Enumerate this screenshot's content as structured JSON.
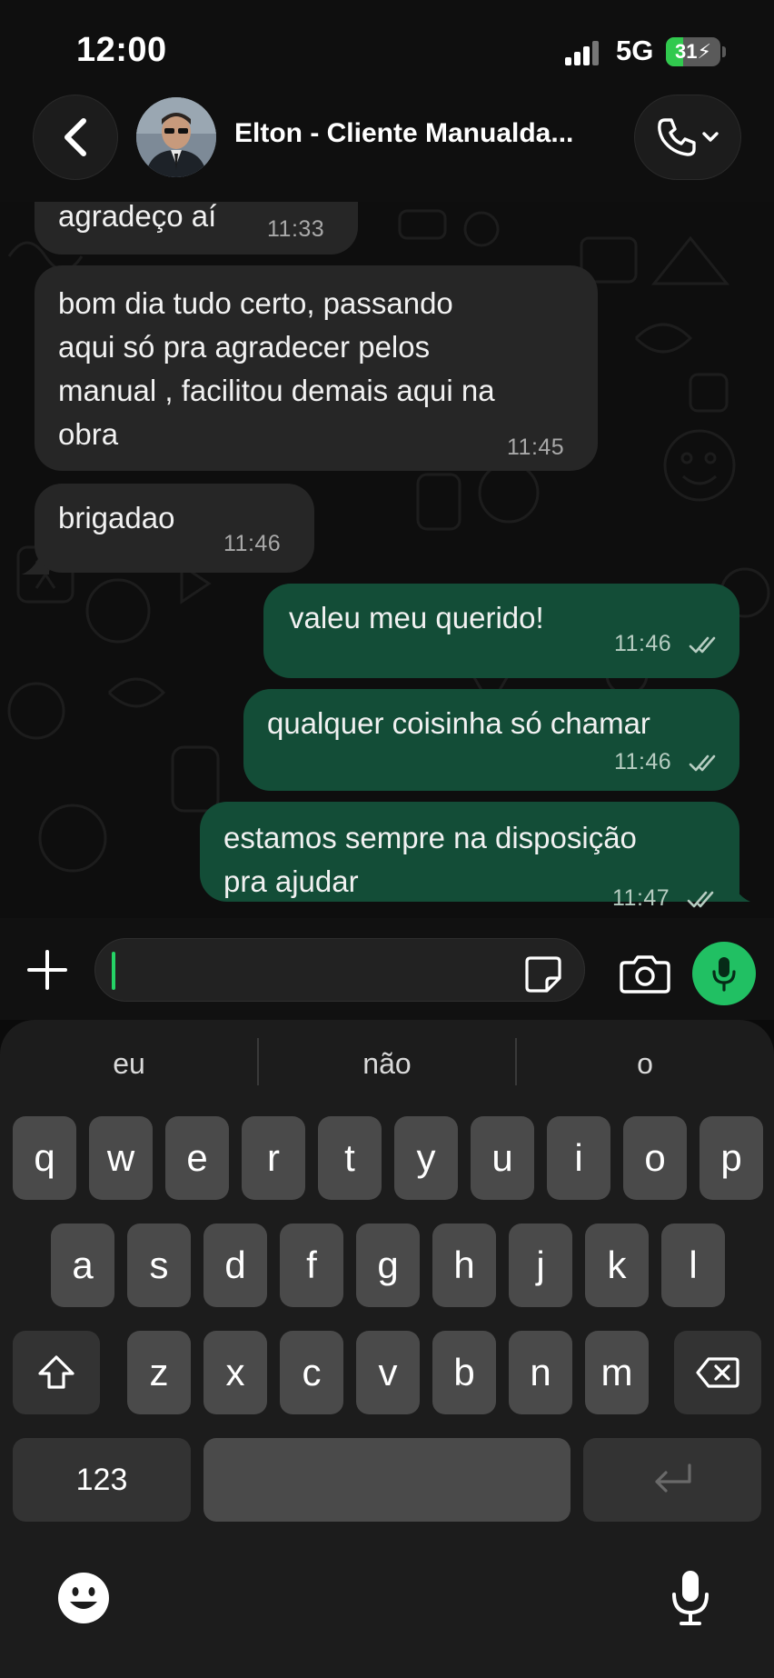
{
  "status_bar": {
    "time": "12:00",
    "network": "5G",
    "battery": "31",
    "battery_level": 0.31
  },
  "header": {
    "contact_name": "Elton - Cliente Manualda...",
    "icons": [
      "back-arrow-icon",
      "avatar",
      "phone-icon",
      "chevron-down-icon"
    ]
  },
  "messages": [
    {
      "direction": "in",
      "text": "agradeço aí",
      "time": "11:33"
    },
    {
      "direction": "in",
      "lines": [
        "bom dia tudo certo, passando",
        "aqui só pra agradecer pelos",
        "manual , facilitou demais aqui na",
        "obra"
      ],
      "time": "11:45"
    },
    {
      "direction": "in",
      "text": "brigadao",
      "time": "11:46"
    },
    {
      "direction": "out",
      "text": "valeu meu querido!",
      "time": "11:46",
      "status": "read"
    },
    {
      "direction": "out",
      "text": "qualquer coisinha só chamar",
      "time": "11:46",
      "status": "read"
    },
    {
      "direction": "out",
      "lines": [
        "estamos sempre na disposição",
        "pra ajudar"
      ],
      "time": "11:47",
      "status": "read"
    }
  ],
  "input": {
    "value": "",
    "icons": [
      "plus-icon",
      "sticker-icon",
      "camera-icon",
      "mic-icon"
    ]
  },
  "keyboard": {
    "suggestions": [
      "eu",
      "não",
      "o"
    ],
    "row1": [
      "q",
      "w",
      "e",
      "r",
      "t",
      "y",
      "u",
      "i",
      "o",
      "p"
    ],
    "row2": [
      "a",
      "s",
      "d",
      "f",
      "g",
      "h",
      "j",
      "k",
      "l"
    ],
    "row3": [
      "z",
      "x",
      "c",
      "v",
      "b",
      "n",
      "m"
    ],
    "numbers_key": "123",
    "icons": [
      "shift-icon",
      "backspace-icon",
      "return-icon",
      "emoji-icon",
      "dictation-mic-icon"
    ]
  },
  "colors": {
    "incoming_bubble": "#262626",
    "outgoing_bubble": "#134d37",
    "accent": "#21c063"
  }
}
